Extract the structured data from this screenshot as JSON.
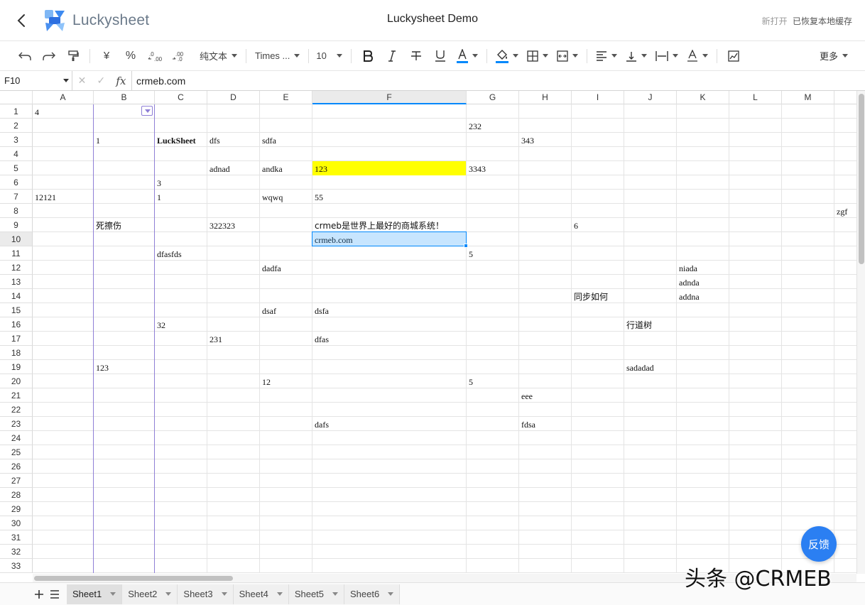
{
  "header": {
    "logo_text": "Luckysheet",
    "title": "Luckysheet Demo",
    "status_new": "新打开",
    "status_restored": "已恢复本地缓存"
  },
  "toolbar": {
    "format_label": "纯文本",
    "font_label": "Times ...",
    "size_label": "10",
    "more_label": "更多",
    "currency_symbol": "¥",
    "percent_symbol": "%",
    "decrease_decimal": ".0←",
    "increase_decimal": ".00→",
    "text_color": "#0188fb",
    "fill_color": "#0188fb"
  },
  "formula_bar": {
    "cell_ref": "F10",
    "fx_label": "fx",
    "value": "crmeb.com"
  },
  "grid": {
    "columns": [
      "A",
      "B",
      "C",
      "D",
      "E",
      "F",
      "G",
      "H",
      "I",
      "J",
      "K",
      "L",
      "M"
    ],
    "active_column": "F",
    "active_row": 10,
    "rows": [
      "1",
      "2",
      "3",
      "4",
      "5",
      "6",
      "7",
      "8",
      "9",
      "10",
      "11",
      "12",
      "13",
      "14",
      "15",
      "16",
      "17",
      "18",
      "19",
      "20",
      "21",
      "22",
      "23",
      "24",
      "25",
      "26",
      "27",
      "28",
      "29",
      "30",
      "31",
      "32",
      "33"
    ],
    "cells": [
      {
        "ref": "A1",
        "text": "4"
      },
      {
        "ref": "G2",
        "text": "232"
      },
      {
        "ref": "B3",
        "text": "1"
      },
      {
        "ref": "C3",
        "text": "LuckSheet",
        "bold": true
      },
      {
        "ref": "D3",
        "text": "dfs"
      },
      {
        "ref": "E3",
        "text": "sdfa"
      },
      {
        "ref": "H3",
        "text": "343"
      },
      {
        "ref": "D5",
        "text": "adnad"
      },
      {
        "ref": "E5",
        "text": "andka"
      },
      {
        "ref": "F5",
        "text": "123",
        "bg": "#ffff00"
      },
      {
        "ref": "G5",
        "text": "3343"
      },
      {
        "ref": "C6",
        "text": "3"
      },
      {
        "ref": "A7",
        "text": "12121"
      },
      {
        "ref": "C7",
        "text": "1"
      },
      {
        "ref": "E7",
        "text": "wqwq"
      },
      {
        "ref": "F7",
        "text": "55"
      },
      {
        "ref": "N8",
        "text": "zgf"
      },
      {
        "ref": "B9",
        "text": "死擦伤",
        "cn": true
      },
      {
        "ref": "D9",
        "text": "322323"
      },
      {
        "ref": "F9",
        "text": "crmeb是世界上最好的商城系统！",
        "cn": true
      },
      {
        "ref": "I9",
        "text": "6"
      },
      {
        "ref": "F10",
        "text": "crmeb.com"
      },
      {
        "ref": "C11",
        "text": "dfasfds"
      },
      {
        "ref": "G11",
        "text": "5"
      },
      {
        "ref": "E12",
        "text": "dadfa"
      },
      {
        "ref": "K12",
        "text": "niada"
      },
      {
        "ref": "K13",
        "text": "adnda"
      },
      {
        "ref": "I14",
        "text": "同步如何",
        "cn": true
      },
      {
        "ref": "K14",
        "text": "addna"
      },
      {
        "ref": "E15",
        "text": "dsaf"
      },
      {
        "ref": "F15",
        "text": "dsfa"
      },
      {
        "ref": "C16",
        "text": "32"
      },
      {
        "ref": "J16",
        "text": "行道树",
        "cn": true
      },
      {
        "ref": "D17",
        "text": "231"
      },
      {
        "ref": "F17",
        "text": "dfas"
      },
      {
        "ref": "B19",
        "text": "123"
      },
      {
        "ref": "J19",
        "text": "sadadad"
      },
      {
        "ref": "E20",
        "text": "12"
      },
      {
        "ref": "G20",
        "text": "5"
      },
      {
        "ref": "H21",
        "text": "eee"
      },
      {
        "ref": "F23",
        "text": "dafs"
      },
      {
        "ref": "H23",
        "text": "fdsa"
      }
    ]
  },
  "sheets": {
    "active": "Sheet1",
    "tabs": [
      "Sheet1",
      "Sheet2",
      "Sheet3",
      "Sheet4",
      "Sheet5",
      "Sheet6"
    ]
  },
  "feedback_label": "反馈",
  "watermark": "头条 @CRMEB"
}
